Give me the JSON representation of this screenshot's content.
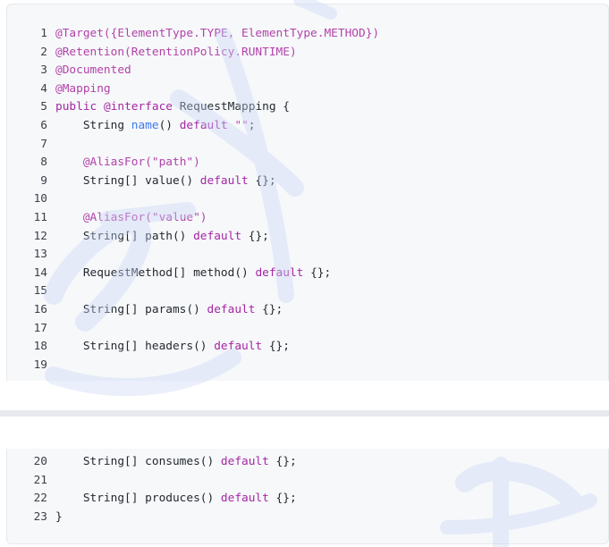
{
  "code_lines": [
    {
      "n": "1",
      "tokens": [
        {
          "t": "@Target({ElementType.TYPE, ElementType.METHOD})",
          "c": "an"
        }
      ]
    },
    {
      "n": "2",
      "tokens": [
        {
          "t": "@Retention(RetentionPolicy.RUNTIME)",
          "c": "an"
        }
      ]
    },
    {
      "n": "3",
      "tokens": [
        {
          "t": "@Documented",
          "c": "an"
        }
      ]
    },
    {
      "n": "4",
      "tokens": [
        {
          "t": "@Mapping",
          "c": "an"
        }
      ]
    },
    {
      "n": "5",
      "tokens": [
        {
          "t": "public",
          "c": "kw"
        },
        {
          "t": " "
        },
        {
          "t": "@interface",
          "c": "kw"
        },
        {
          "t": " RequestMapping {"
        }
      ]
    },
    {
      "n": "6",
      "tokens": [
        {
          "t": "    String "
        },
        {
          "t": "name",
          "c": "fn"
        },
        {
          "t": "() "
        },
        {
          "t": "default",
          "c": "kw"
        },
        {
          "t": " "
        },
        {
          "t": "\"\"",
          "c": "str"
        },
        {
          "t": ";"
        }
      ]
    },
    {
      "n": "7",
      "tokens": []
    },
    {
      "n": "8",
      "tokens": [
        {
          "t": "    "
        },
        {
          "t": "@AliasFor(\"path\")",
          "c": "an"
        }
      ]
    },
    {
      "n": "9",
      "tokens": [
        {
          "t": "    String[] value() "
        },
        {
          "t": "default",
          "c": "kw"
        },
        {
          "t": " {};"
        }
      ]
    },
    {
      "n": "10",
      "tokens": []
    },
    {
      "n": "11",
      "tokens": [
        {
          "t": "    "
        },
        {
          "t": "@AliasFor(\"value\")",
          "c": "an"
        }
      ]
    },
    {
      "n": "12",
      "tokens": [
        {
          "t": "    String[] path() "
        },
        {
          "t": "default",
          "c": "kw"
        },
        {
          "t": " {};"
        }
      ]
    },
    {
      "n": "13",
      "tokens": []
    },
    {
      "n": "14",
      "tokens": [
        {
          "t": "    RequestMethod[] method() "
        },
        {
          "t": "default",
          "c": "kw"
        },
        {
          "t": " {};"
        }
      ]
    },
    {
      "n": "15",
      "tokens": []
    },
    {
      "n": "16",
      "tokens": [
        {
          "t": "    String[] params() "
        },
        {
          "t": "default",
          "c": "kw"
        },
        {
          "t": " {};"
        }
      ]
    },
    {
      "n": "17",
      "tokens": []
    },
    {
      "n": "18",
      "tokens": [
        {
          "t": "    String[] headers() "
        },
        {
          "t": "default",
          "c": "kw"
        },
        {
          "t": " {};"
        }
      ]
    },
    {
      "n": "19",
      "tokens": []
    },
    {
      "n": "20",
      "tokens": [
        {
          "t": "    String[] consumes() "
        },
        {
          "t": "default",
          "c": "kw"
        },
        {
          "t": " {};"
        }
      ]
    },
    {
      "n": "21",
      "tokens": []
    },
    {
      "n": "22",
      "tokens": [
        {
          "t": "    String[] produces() "
        },
        {
          "t": "default",
          "c": "kw"
        },
        {
          "t": " {};"
        }
      ]
    },
    {
      "n": "23",
      "tokens": [
        {
          "t": "}"
        }
      ]
    }
  ],
  "colors": {
    "background": "#f6f8fa",
    "keyword": "#a626a4",
    "annotation": "#b342a8",
    "function": "#4078f2",
    "string": "#c74bb5",
    "watermark": "#c9d6f7"
  },
  "watermark_icon": "calligraphy-watermark-icon"
}
